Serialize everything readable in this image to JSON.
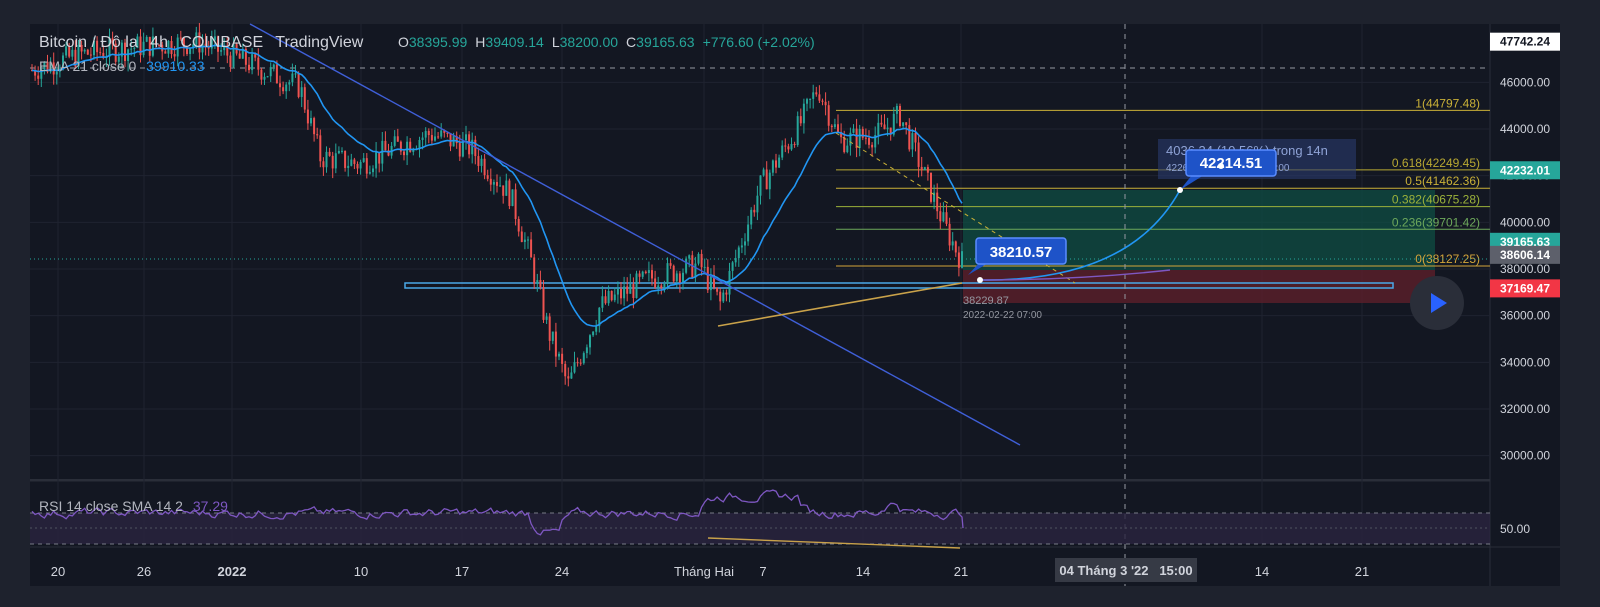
{
  "header": {
    "symbol": "Bitcoin / Đô la",
    "interval": "4h",
    "exchange": "COINBASE",
    "platform": "TradingView",
    "ohlc": [
      {
        "k": "O",
        "v": "38395.99"
      },
      {
        "k": "H",
        "v": "39409.14"
      },
      {
        "k": "L",
        "v": "38200.00"
      },
      {
        "k": "C",
        "v": "39165.63"
      }
    ],
    "change": "+776.60 (+2.02%)"
  },
  "ema": {
    "label": "EMA 21 close 0",
    "value": "39910.33"
  },
  "rsi": {
    "label": "RSI 14 close SMA 14 2",
    "value": "37.29",
    "axis_label": "50.00"
  },
  "colors": {
    "background": "#131722",
    "up": "#26a69a",
    "down": "#ef5350",
    "ema": "#2196f3",
    "trendline": "#3f5fd8",
    "fib": "#c9b037",
    "rsi": "#7e57c2",
    "support_line": "#4aa8e8",
    "target_zone": "#1a5c4f",
    "stop_zone": "#7a2733",
    "divergence": "#c9a24a"
  },
  "price_axis": {
    "ticks": [
      "46000.00",
      "44000.00",
      "42000.00",
      "40000.00",
      "38000.00",
      "36000.00",
      "34000.00",
      "32000.00",
      "30000.00"
    ],
    "tags": [
      {
        "label": "47742.24",
        "color": "#ffffff",
        "text_color": "#131722"
      },
      {
        "label": "42232.01",
        "color": "#26a69a",
        "text_color": "#ffffff"
      },
      {
        "label": "39165.63",
        "color": "#26a69a",
        "text_color": "#ffffff"
      },
      {
        "label": "38606.14",
        "color": "#5d606b",
        "text_color": "#ffffff"
      },
      {
        "label": "37169.47",
        "color": "#f23645",
        "text_color": "#ffffff"
      }
    ]
  },
  "time_axis": {
    "ticks": [
      {
        "label": "20",
        "bold": false
      },
      {
        "label": "26",
        "bold": false
      },
      {
        "label": "2022",
        "bold": true
      },
      {
        "label": "10",
        "bold": false
      },
      {
        "label": "17",
        "bold": false
      },
      {
        "label": "24",
        "bold": false
      },
      {
        "label": "Tháng Hai",
        "bold": false
      },
      {
        "label": "7",
        "bold": false
      },
      {
        "label": "14",
        "bold": false
      },
      {
        "label": "21",
        "bold": false
      },
      {
        "label": "14",
        "bold": false
      },
      {
        "label": "21",
        "bold": false
      }
    ],
    "crosshair_label": "04 Tháng 3 '22   15:00"
  },
  "fib_levels": [
    {
      "label": "1(44797.48)"
    },
    {
      "label": "0.618(42249.45)"
    },
    {
      "label": "0.5(41462.36)"
    },
    {
      "label": "0.382(40675.28)"
    },
    {
      "label": "0.236(39701.42)"
    },
    {
      "label": "0(38127.25)"
    }
  ],
  "annotations": {
    "callout_low": "38210.57",
    "callout_high": "42214.51",
    "measure_text": "4036.34 (10.56%) trong 14n",
    "measure_sub": "42266.07   2022-03-03  07:00",
    "low_price": "38229.87",
    "low_date": "2022-02-22 07:00"
  },
  "chart_data": {
    "type": "candlestick",
    "timeframe": "4h",
    "x_axis": [
      "20",
      "26",
      "2022",
      "10",
      "17",
      "24",
      "Tháng Hai",
      "7",
      "14",
      "21",
      "14",
      "21"
    ],
    "ylim": [
      29000,
      48500
    ],
    "ema_period": 21,
    "key_points": [
      {
        "label": "early Jan high",
        "price": 47700
      },
      {
        "label": "Jan 24 low",
        "price": 33000
      },
      {
        "label": "Feb 10 high",
        "price": 45800
      },
      {
        "label": "Feb 22 low",
        "price": 38229.87
      }
    ],
    "last_ohlc": {
      "open": 38395.99,
      "high": 39409.14,
      "low": 38200.0,
      "close": 39165.63
    },
    "ema21_last": 39910.33,
    "rsi14_last": 37.29,
    "fibonacci": [
      {
        "ratio": 1,
        "price": 44797.48
      },
      {
        "ratio": 0.618,
        "price": 42249.45
      },
      {
        "ratio": 0.5,
        "price": 41462.36
      },
      {
        "ratio": 0.382,
        "price": 40675.28
      },
      {
        "ratio": 0.236,
        "price": 39701.42
      },
      {
        "ratio": 0,
        "price": 38127.25
      }
    ],
    "position": {
      "entry": 38606.14,
      "target": 42232.01,
      "stop": 37169.47
    },
    "projection": {
      "from": 38210.57,
      "to": 42214.51,
      "change": 4036.34,
      "change_pct": 10.56
    }
  }
}
